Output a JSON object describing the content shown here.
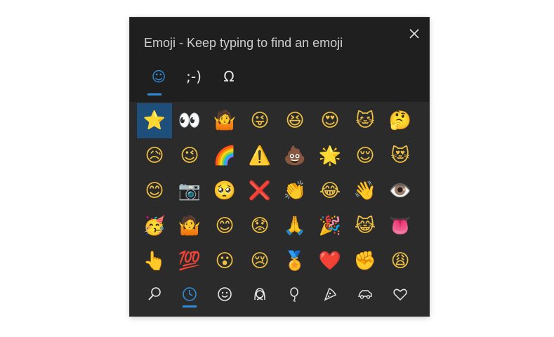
{
  "window": {
    "title": "Emoji - Keep typing to find an emoji",
    "close_icon": "close-icon"
  },
  "tabs": [
    {
      "label": "☺",
      "name": "emoji",
      "active": true
    },
    {
      "label": ";-)",
      "name": "kaomoji",
      "active": false
    },
    {
      "label": "Ω",
      "name": "symbols",
      "active": false
    }
  ],
  "emoji_grid": [
    "⭐",
    "👀",
    "🤷",
    "😜",
    "😆",
    "😍",
    "🐱",
    "🤔",
    "😥",
    "😉",
    "🌈",
    "⚠️",
    "💩",
    "🌟",
    "😌",
    "😻",
    "😊",
    "📷",
    "🥺",
    "❌",
    "👏",
    "😂",
    "👋",
    "👁️",
    "🥳",
    "🤷",
    "😊",
    "😟",
    "🙏",
    "🎉",
    "😹",
    "👅",
    "👆",
    "💯",
    "😮",
    "😢",
    "🏅",
    "❤️",
    "✊",
    "😩"
  ],
  "selected_index": 0,
  "categories": [
    {
      "name": "search",
      "icon": "search-icon",
      "active": false
    },
    {
      "name": "recent",
      "icon": "clock-icon",
      "active": true
    },
    {
      "name": "smileys",
      "icon": "smiley-icon",
      "active": false
    },
    {
      "name": "people",
      "icon": "person-icon",
      "active": false
    },
    {
      "name": "celebration",
      "icon": "balloon-icon",
      "active": false
    },
    {
      "name": "food",
      "icon": "pizza-icon",
      "active": false
    },
    {
      "name": "transport",
      "icon": "car-icon",
      "active": false
    },
    {
      "name": "symbols",
      "icon": "heart-icon",
      "active": false
    }
  ],
  "colors": {
    "accent": "#2f8bd8",
    "header_bg": "#1f1f1f",
    "body_bg": "#2b2b2b",
    "selected_bg": "#1e4f7a"
  }
}
